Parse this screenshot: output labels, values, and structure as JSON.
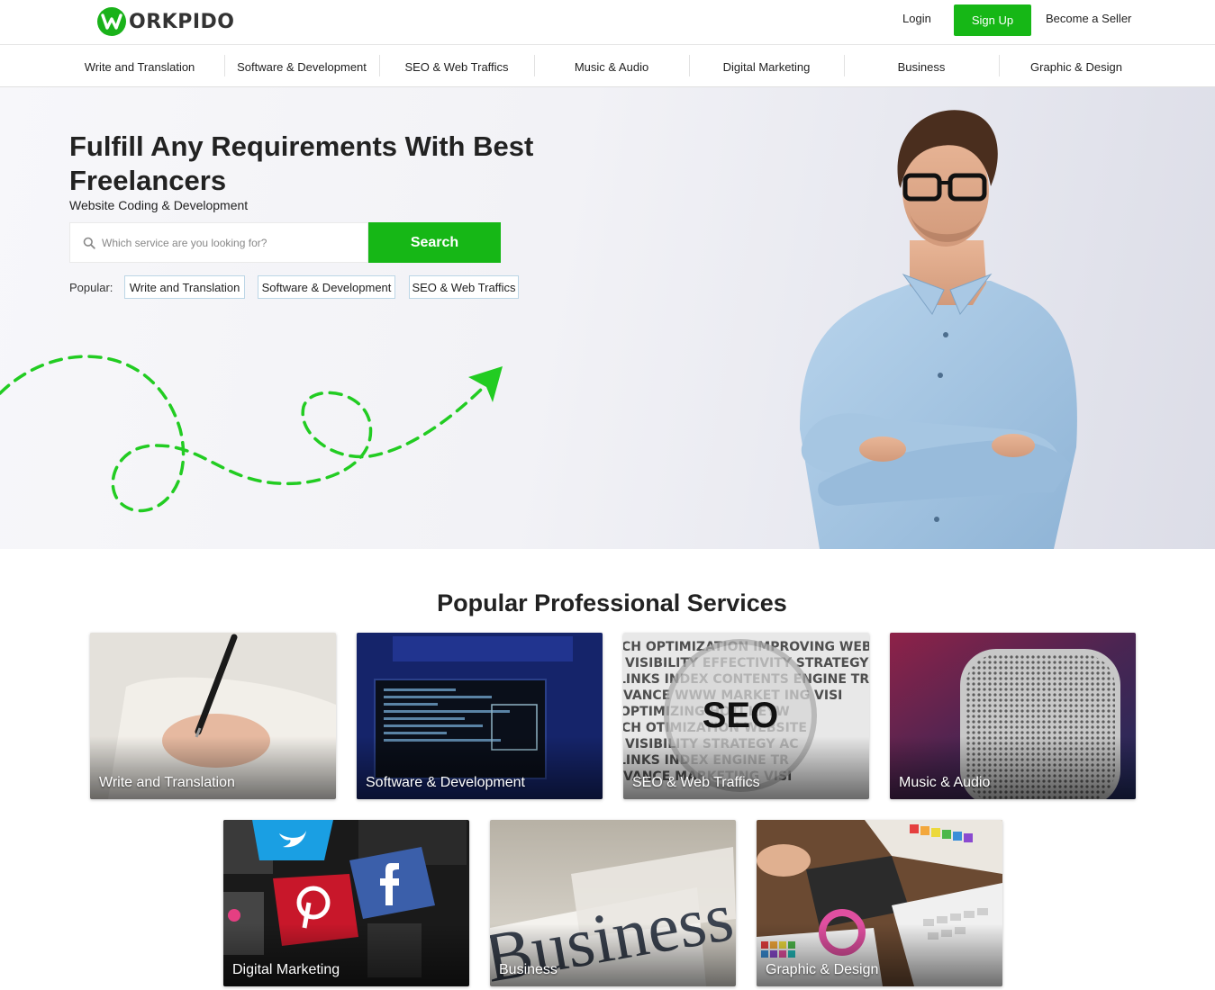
{
  "header": {
    "logo_text": "ORKPIDO",
    "login_label": "Login",
    "signup_label": "Sign Up",
    "seller_label": "Become a Seller",
    "brand_color": "#16b716"
  },
  "categories": [
    "Write and Translation",
    "Software & Development",
    "SEO & Web Traffics",
    "Music & Audio",
    "Digital Marketing",
    "Business",
    "Graphic & Design"
  ],
  "hero": {
    "title": "Fulfill Any Requirements With Best Freelancers",
    "subtitle": "Website Coding & Development",
    "search_placeholder": "Which service are you looking for?",
    "search_button": "Search",
    "popular_label": "Popular:",
    "popular_tags": [
      "Write and Translation",
      "Software & Development",
      "SEO & Web Traffics"
    ]
  },
  "services": {
    "title": "Popular Professional Services",
    "cards": [
      {
        "label": "Write and Translation"
      },
      {
        "label": "Software & Development"
      },
      {
        "label": "SEO & Web Traffics",
        "image_text": "SEO"
      },
      {
        "label": "Music & Audio"
      },
      {
        "label": "Digital Marketing"
      },
      {
        "label": "Business",
        "image_text": "Business"
      },
      {
        "label": "Graphic & Design"
      }
    ]
  },
  "icons": [
    "logo-w-icon",
    "search-icon",
    "paper-plane-icon",
    "twitter-icon",
    "pinterest-icon",
    "facebook-icon"
  ]
}
